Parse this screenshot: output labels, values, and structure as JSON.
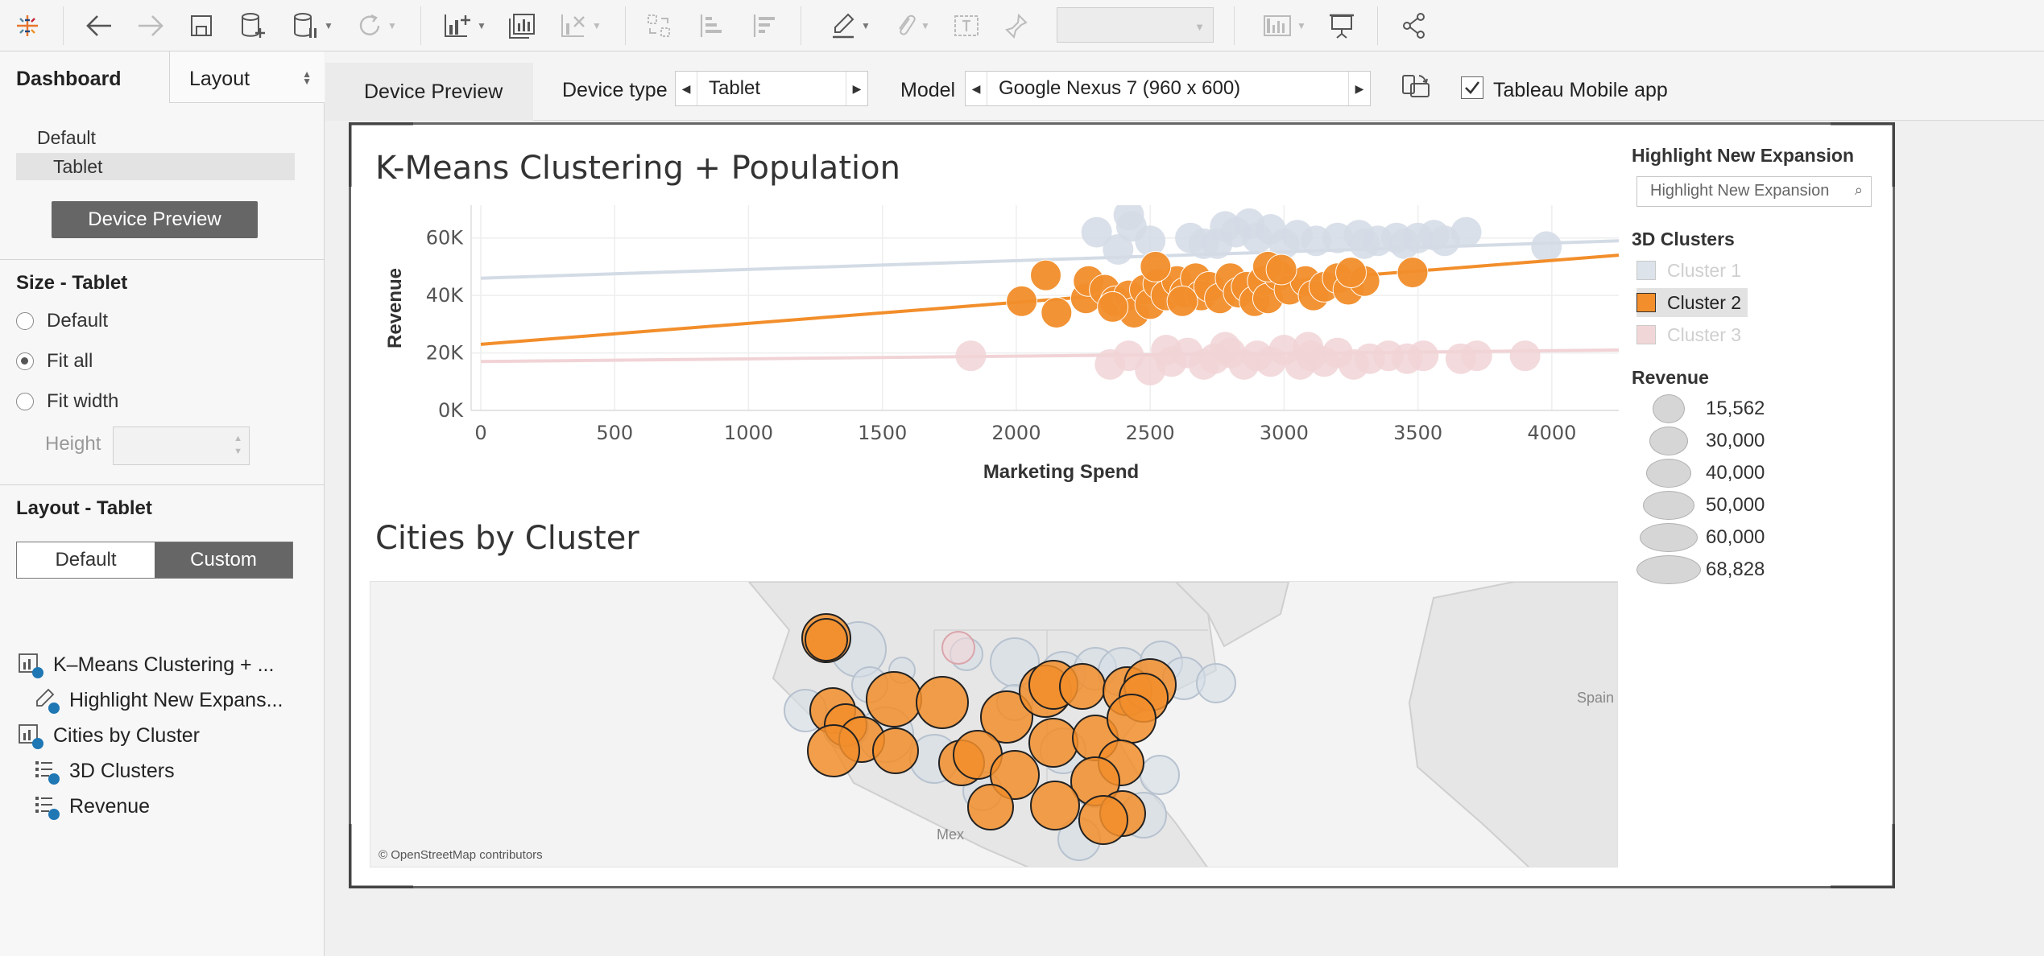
{
  "toolbar": {
    "icons": [
      "tableau-logo-icon",
      "back-icon",
      "forward-icon",
      "save-icon",
      "new-datasource-icon",
      "pause-updates-icon",
      "refresh-icon",
      "new-worksheet-icon",
      "duplicate-icon",
      "clear-icon",
      "swap-icon",
      "sort-asc-icon",
      "sort-desc-icon",
      "highlight-icon",
      "annotate-icon",
      "fit-icon",
      "fix-axes-icon",
      "show-me-icon",
      "presentation-icon",
      "share-icon"
    ],
    "combo_value": ""
  },
  "left_panel": {
    "tabs": {
      "dashboard": "Dashboard",
      "layout": "Layout"
    },
    "devices": [
      "Default",
      "Tablet"
    ],
    "device_preview_button": "Device Preview",
    "size_title": "Size - Tablet",
    "size_options": [
      "Default",
      "Fit all",
      "Fit width"
    ],
    "height_label": "Height",
    "height_value": "",
    "layout_title": "Layout - Tablet",
    "layout_default": "Default",
    "layout_custom": "Custom",
    "tree": [
      {
        "label": "K–Means Clustering + ...",
        "icon": "worksheet-icon",
        "indent": 0
      },
      {
        "label": "Highlight New Expans...",
        "icon": "highlighter-icon",
        "indent": 1
      },
      {
        "label": "Cities by Cluster",
        "icon": "worksheet-icon",
        "indent": 0
      },
      {
        "label": "3D Clusters",
        "icon": "legend-icon",
        "indent": 1
      },
      {
        "label": "Revenue",
        "icon": "legend-icon",
        "indent": 1
      }
    ]
  },
  "device_bar": {
    "tab": "Device Preview",
    "device_type_label": "Device type",
    "device_type_value": "Tablet",
    "model_label": "Model",
    "model_value": "Google Nexus 7 (960 x 600)",
    "mobile_app_label": "Tableau Mobile app",
    "mobile_app_checked": true
  },
  "dashboard": {
    "kmeans_title": "K-Means Clustering + Population",
    "cities_title": "Cities by Cluster",
    "map_credit": "© OpenStreetMap contributors",
    "map_labels": [
      "Spain",
      "Mex"
    ],
    "legends": {
      "highlight_title": "Highlight New Expansion",
      "highlight_placeholder": "Highlight New Expansion",
      "clusters_title": "3D Clusters",
      "clusters": [
        {
          "name": "Cluster 1",
          "color": "#dde3ea",
          "active": false
        },
        {
          "name": "Cluster 2",
          "color": "#f28e2b",
          "active": true
        },
        {
          "name": "Cluster 3",
          "color": "#f1d6d8",
          "active": false
        }
      ],
      "revenue_title": "Revenue",
      "revenue_values": [
        "15,562",
        "30,000",
        "40,000",
        "50,000",
        "60,000",
        "68,828"
      ]
    }
  },
  "chart_data": {
    "type": "scatter",
    "title": "K-Means Clustering + Population",
    "xlabel": "Marketing Spend",
    "ylabel": "Revenue",
    "xlim": [
      0,
      4250
    ],
    "ylim": [
      0,
      70000
    ],
    "x_ticks": [
      "0",
      "500",
      "1000",
      "1500",
      "2000",
      "2500",
      "3000",
      "3500",
      "4000"
    ],
    "y_ticks": [
      "0K",
      "20K",
      "40K",
      "60K"
    ],
    "colors": {
      "Cluster 1": "#d3dbe5",
      "Cluster 2": "#f28e2b",
      "Cluster 3": "#f1d3d6"
    },
    "series": [
      {
        "name": "Cluster 1",
        "trend": [
          [
            0,
            46000
          ],
          [
            4250,
            59000
          ]
        ],
        "points": [
          [
            2300,
            62000
          ],
          [
            2430,
            64000
          ],
          [
            2500,
            59000
          ],
          [
            2650,
            60000
          ],
          [
            2750,
            58000
          ],
          [
            2820,
            62000
          ],
          [
            2900,
            60000
          ],
          [
            2950,
            63000
          ],
          [
            3050,
            61000
          ],
          [
            3120,
            59000
          ],
          [
            3200,
            60000
          ],
          [
            3280,
            61000
          ],
          [
            3350,
            59000
          ],
          [
            3420,
            60000
          ],
          [
            3500,
            60000
          ],
          [
            3560,
            61000
          ],
          [
            3600,
            59000
          ],
          [
            3680,
            62000
          ],
          [
            2380,
            56000
          ],
          [
            2700,
            58000
          ],
          [
            3000,
            58000
          ],
          [
            3300,
            58000
          ],
          [
            3450,
            58000
          ],
          [
            3980,
            57000
          ],
          [
            2420,
            68000
          ],
          [
            2780,
            64000
          ],
          [
            2870,
            65000
          ]
        ]
      },
      {
        "name": "Cluster 2",
        "trend": [
          [
            0,
            23000
          ],
          [
            4250,
            54000
          ]
        ],
        "points": [
          [
            2020,
            38000
          ],
          [
            2110,
            47000
          ],
          [
            2150,
            34000
          ],
          [
            2260,
            39000
          ],
          [
            2270,
            45000
          ],
          [
            2330,
            42000
          ],
          [
            2370,
            38000
          ],
          [
            2420,
            40000
          ],
          [
            2440,
            34000
          ],
          [
            2480,
            42000
          ],
          [
            2500,
            37000
          ],
          [
            2530,
            44000
          ],
          [
            2560,
            40000
          ],
          [
            2600,
            45000
          ],
          [
            2630,
            41000
          ],
          [
            2670,
            46000
          ],
          [
            2690,
            40000
          ],
          [
            2720,
            43000
          ],
          [
            2760,
            39000
          ],
          [
            2800,
            46000
          ],
          [
            2830,
            41000
          ],
          [
            2860,
            43000
          ],
          [
            2890,
            38000
          ],
          [
            2920,
            45000
          ],
          [
            2940,
            39000
          ],
          [
            2980,
            47000
          ],
          [
            3020,
            42000
          ],
          [
            3080,
            45000
          ],
          [
            3110,
            40000
          ],
          [
            3150,
            43000
          ],
          [
            3200,
            46000
          ],
          [
            3240,
            42000
          ],
          [
            3300,
            45000
          ],
          [
            3480,
            48000
          ],
          [
            2520,
            50000
          ],
          [
            2940,
            50000
          ],
          [
            2990,
            49000
          ],
          [
            3250,
            48000
          ],
          [
            2360,
            36000
          ],
          [
            2620,
            38000
          ]
        ]
      },
      {
        "name": "Cluster 3",
        "trend": [
          [
            0,
            17000
          ],
          [
            4250,
            21000
          ]
        ],
        "points": [
          [
            1830,
            19000
          ],
          [
            2350,
            16000
          ],
          [
            2420,
            19000
          ],
          [
            2500,
            14000
          ],
          [
            2580,
            17000
          ],
          [
            2640,
            20000
          ],
          [
            2700,
            16000
          ],
          [
            2740,
            18000
          ],
          [
            2800,
            20000
          ],
          [
            2850,
            16000
          ],
          [
            2900,
            19000
          ],
          [
            2950,
            17000
          ],
          [
            3000,
            21000
          ],
          [
            3060,
            16000
          ],
          [
            3100,
            19000
          ],
          [
            3150,
            17000
          ],
          [
            3200,
            20000
          ],
          [
            3260,
            16000
          ],
          [
            3320,
            18000
          ],
          [
            3390,
            19000
          ],
          [
            3460,
            18000
          ],
          [
            3520,
            19000
          ],
          [
            3660,
            18000
          ],
          [
            3720,
            19000
          ],
          [
            3900,
            19000
          ],
          [
            2560,
            21000
          ],
          [
            2780,
            22000
          ],
          [
            3090,
            22000
          ]
        ]
      }
    ]
  },
  "map_data": {
    "active_color": "#f28e2b",
    "inactive_color": "#d6dde6"
  }
}
